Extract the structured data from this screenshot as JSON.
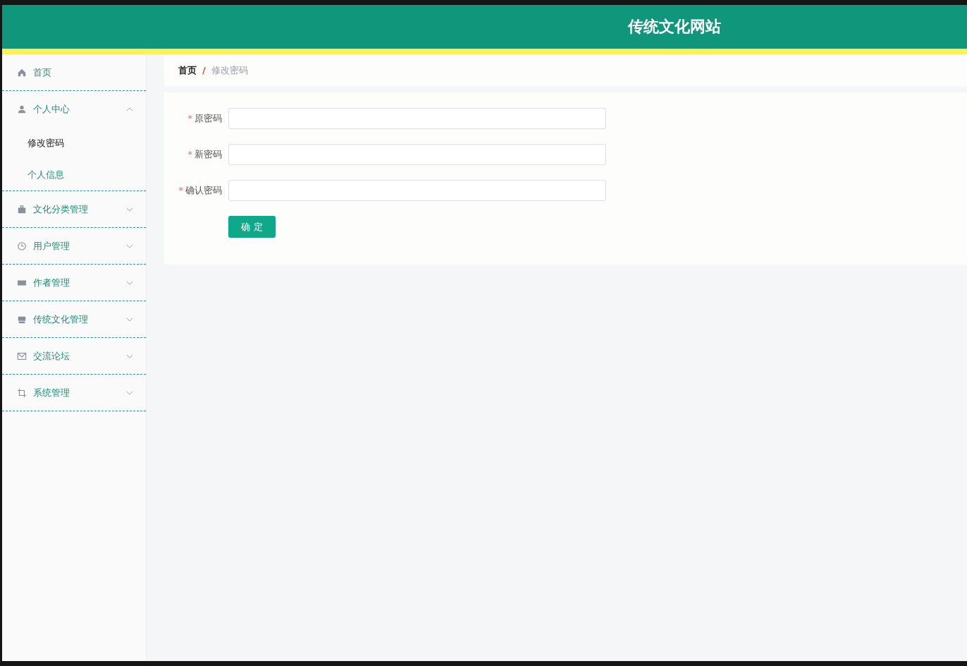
{
  "header": {
    "title": "传统文化网站"
  },
  "sidebar": {
    "items": [
      {
        "label": "首页"
      },
      {
        "label": "个人中心",
        "expanded": true,
        "children": [
          {
            "label": "修改密码",
            "selected": true
          },
          {
            "label": "个人信息",
            "selected": false
          }
        ]
      },
      {
        "label": "文化分类管理",
        "expanded": false
      },
      {
        "label": "用户管理",
        "expanded": false
      },
      {
        "label": "作者管理",
        "expanded": false
      },
      {
        "label": "传统文化管理",
        "expanded": false
      },
      {
        "label": "交流论坛",
        "expanded": false
      },
      {
        "label": "系统管理",
        "expanded": false
      }
    ]
  },
  "breadcrumb": {
    "separator": "/",
    "items": [
      "首页",
      "修改密码"
    ]
  },
  "form": {
    "required_mark": "*",
    "fields": [
      {
        "label": "原密码",
        "required": true
      },
      {
        "label": "新密码",
        "required": true
      },
      {
        "label": "确认密码",
        "required": true
      }
    ],
    "submit": "确 定"
  }
}
